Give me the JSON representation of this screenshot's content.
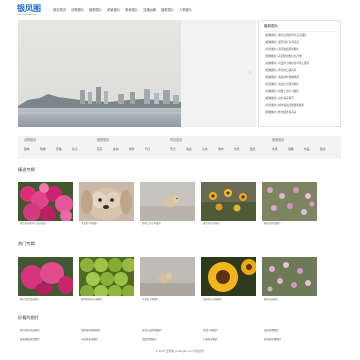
{
  "header": {
    "logo": "银凤图",
    "logo_sub": "www.yinfengtu.com",
    "nav": [
      "网站首页",
      "动物图片",
      "植物图片",
      "风景图片",
      "美食图片",
      "交通运输",
      "建筑图片",
      "人物图片"
    ]
  },
  "slider": {
    "prev": "‹",
    "next": "›"
  },
  "sidebar": {
    "title": "最新图片",
    "items": [
      "[植物图片] 紫红色羽毛叶片花卉图片",
      "[植物图片] 盛开的红色鸡冠花",
      "[风景图片] 满天晚霞风景图片",
      "[植物图片] 花园里的粉红色月季",
      "[动物图片] 可爱的小狗趴在草地上图片",
      "[植物图片] 黄色向日葵花海",
      "[植物图片] 清新绿叶植物壁纸",
      "[风景图片] 海边日出风景图片",
      "[动物图片] 树枝上的小鸟图片",
      "[植物图片] 白色菊花特写",
      "[风景图片] 城市湖边高楼建筑图片",
      "[植物图片] 粉色郁金香花朵"
    ]
  },
  "categories": [
    {
      "title": "动物图片",
      "links": [
        "猫咪",
        "狗狗",
        "熊猫",
        "兔子"
      ]
    },
    {
      "title": "植物图片",
      "links": [
        "花卉",
        "多肉",
        "绿萝",
        "竹子"
      ]
    },
    {
      "title": "风景图片",
      "links": [
        "天空",
        "海边",
        "山水",
        "城市",
        "雪景",
        "夜景"
      ]
    },
    {
      "title": "美食图片",
      "links": [
        "水果",
        "蛋糕",
        "饮品",
        "甜点"
      ]
    }
  ],
  "sections": {
    "featured": {
      "title": "精选专辑",
      "captions": [
        "紫红色羽毛叶片花卉图片",
        "可爱的小狗图片",
        "草地上的小狗图片",
        "黄色的向日葵花",
        "粉色的野花图片"
      ]
    },
    "hot": {
      "title": "热门专辑",
      "captions": [
        "粉红色鸡冠花图片",
        "新鲜的绿色水果图片",
        "可爱的小狗图片",
        "金黄色向日葵图片",
        "粉色花朵图片"
      ]
    },
    "recommended": {
      "title": "好看的图片",
      "items": [
        "粉红色的花朵图片",
        "清新绿叶植物图片",
        "蓝天白云风景图片",
        "可爱小狗图片",
        "海边风景图片",
        "城市建筑夜景图片",
        "向日葵花海图片",
        "湖边风景图片",
        "白色菊花图片",
        "粉色郁金香图片"
      ]
    }
  },
  "footer": {
    "text": "© 2023 银凤图 yinfengtu.com 版权所有"
  },
  "colors": {
    "logo": "#1a6fc4",
    "category_bar": "#f3f3f3",
    "background": "#ffffff"
  }
}
